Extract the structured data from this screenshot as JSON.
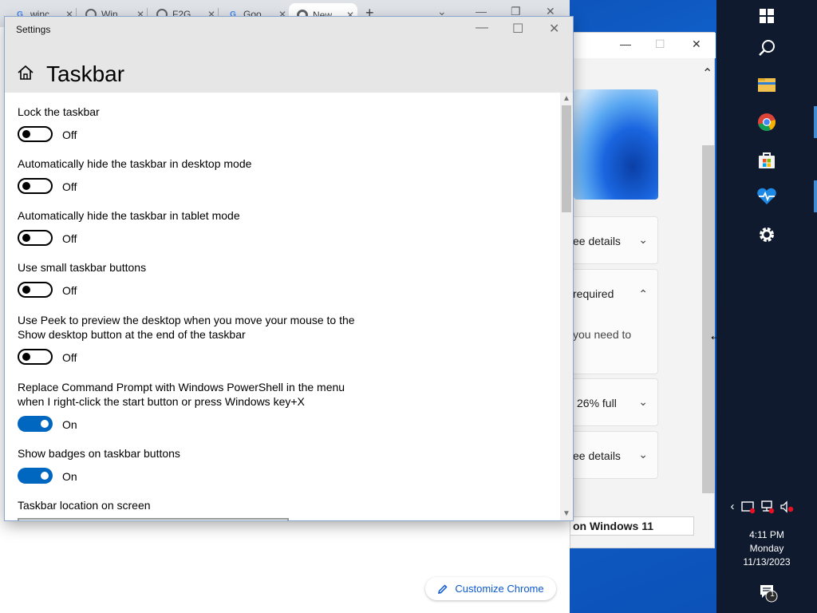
{
  "chrome": {
    "tabs": [
      {
        "label": "winc",
        "fav_letter": "G",
        "fav_color": "#4285f4"
      },
      {
        "label": "Win",
        "fav_letter": "",
        "fav_color": "#5f6368"
      },
      {
        "label": "F2G",
        "fav_letter": "",
        "fav_color": "#5f6368"
      },
      {
        "label": "Goo",
        "fav_letter": "G",
        "fav_color": "#4285f4"
      },
      {
        "label": "New",
        "fav_letter": "",
        "fav_color": "#5f6368"
      }
    ],
    "new_tab": "+",
    "customize_label": "Customize Chrome"
  },
  "health": {
    "cards": [
      {
        "text": "ee details",
        "chevron": "down"
      },
      {
        "text": "required",
        "chevron": "up",
        "sub": "you need to"
      },
      {
        "text": "26% full",
        "chevron": "down"
      },
      {
        "text": "ee details",
        "chevron": "down"
      }
    ],
    "field_text": "on Windows 11"
  },
  "settings": {
    "window_title": "Settings",
    "page_title": "Taskbar",
    "options": [
      {
        "label": "Lock the taskbar",
        "state": "Off"
      },
      {
        "label": "Automatically hide the taskbar in desktop mode",
        "state": "Off"
      },
      {
        "label": "Automatically hide the taskbar in tablet mode",
        "state": "Off"
      },
      {
        "label": "Use small taskbar buttons",
        "state": "Off"
      },
      {
        "label": "Use Peek to preview the desktop when you move your mouse to the Show desktop button at the end of the taskbar",
        "state": "Off"
      },
      {
        "label": "Replace Command Prompt with Windows PowerShell in the menu when I right-click the start button or press Windows key+X",
        "state": "On"
      },
      {
        "label": "Show badges on taskbar buttons",
        "state": "On"
      }
    ],
    "location_label": "Taskbar location on screen"
  },
  "taskbar": {
    "icons": [
      "windows-start-icon",
      "search-icon",
      "file-explorer-icon",
      "chrome-icon",
      "microsoft-store-icon",
      "pc-health-icon",
      "settings-gear-icon"
    ],
    "clock": {
      "time": "4:11 PM",
      "day": "Monday",
      "date": "11/13/2023"
    },
    "notification_count": "1"
  },
  "colors": {
    "accent": "#0067c0",
    "taskbar_bg": "#101a2e",
    "chrome_link": "#0b57d0"
  }
}
